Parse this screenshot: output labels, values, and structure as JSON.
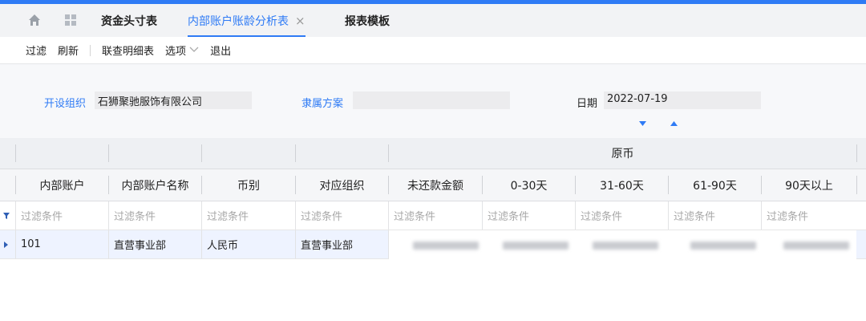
{
  "tabs": [
    {
      "label": "资金头寸表"
    },
    {
      "label": "内部账户账龄分析表",
      "close": "×"
    },
    {
      "label": "报表模板"
    }
  ],
  "toolbar": {
    "filter": "过滤",
    "refresh": "刷新",
    "detail": "联查明细表",
    "options": "选项",
    "exit": "退出"
  },
  "filters": {
    "org_label": "开设组织",
    "org_value": "石狮聚驰服饰有限公司",
    "scheme_label": "隶属方案",
    "scheme_value": "",
    "date_label": "日期",
    "date_value": "2022-07-19"
  },
  "table": {
    "group_header": "原币",
    "columns": [
      "内部账户",
      "内部账户名称",
      "币别",
      "对应组织",
      "未还款金额",
      "0-30天",
      "31-60天",
      "61-90天",
      "90天以上"
    ],
    "filter_placeholder": "过滤条件",
    "rows": [
      {
        "account": "101",
        "account_name": "直营事业部",
        "currency": "人民币",
        "org": "直营事业部"
      }
    ]
  },
  "colors": {
    "accent": "#2f7bf5"
  }
}
